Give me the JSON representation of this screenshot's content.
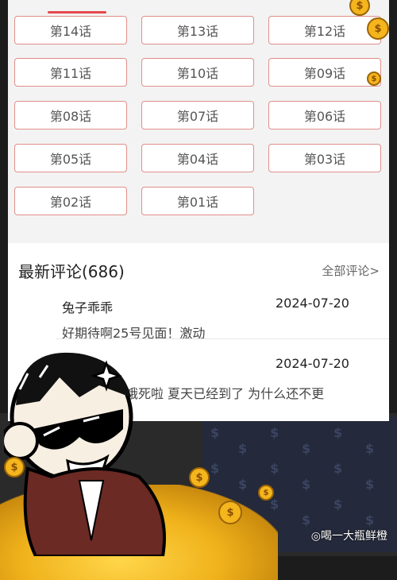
{
  "chapters": [
    "第14话",
    "第13话",
    "第12话",
    "第11话",
    "第10话",
    "第09话",
    "第08话",
    "第07话",
    "第06话",
    "第05话",
    "第04话",
    "第03话",
    "第02话",
    "第01话"
  ],
  "comments_section": {
    "title": "最新评论(686)",
    "all_link": "全部评论>",
    "items": [
      {
        "name": "兔子乖乖",
        "date": "2024-07-20",
        "text": "好期待啊25号见面！激动"
      },
      {
        "name": "",
        "date": "2024-07-20",
        "text": "饿死啦 夏天已经到了 为什么还不更"
      }
    ]
  },
  "watermark": "◎喝一大瓶鲜橙",
  "coin_symbol": "$"
}
